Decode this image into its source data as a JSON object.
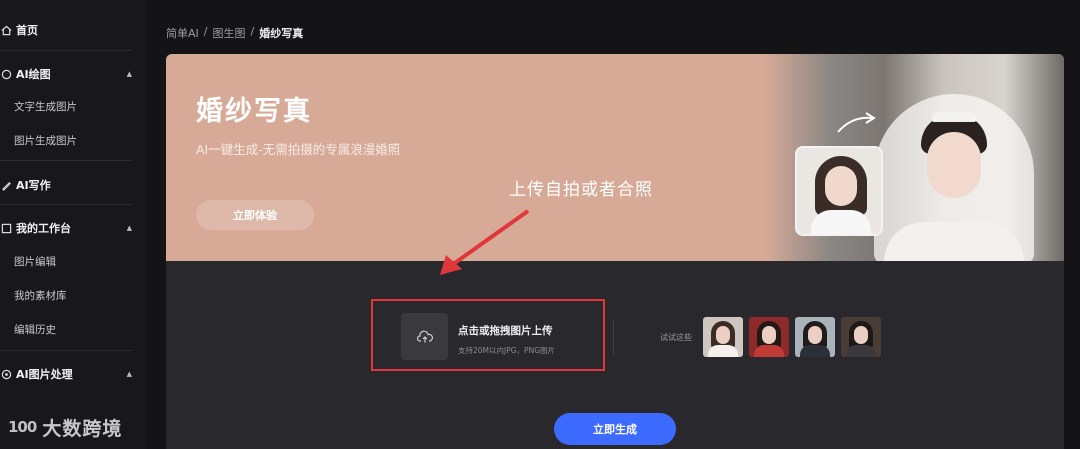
{
  "sidebar": {
    "home": "首页",
    "ai_draw": "AI绘图",
    "ai_draw_items": [
      "文字生成图片",
      "图片生成图片"
    ],
    "ai_write": "AI写作",
    "workspace": "我的工作台",
    "workspace_items": [
      "图片编辑",
      "我的素材库",
      "编辑历史"
    ],
    "ai_image": "AI图片处理"
  },
  "breadcrumb": [
    "简单AI",
    "/",
    "图生图",
    "/",
    "婚纱写真"
  ],
  "banner": {
    "title": "婚纱写真",
    "subtitle": "AI一键生成-无需拍摄的专属浪漫婚照",
    "try_button": "立即体验",
    "callout": "上传自拍或者合照"
  },
  "upload": {
    "title": "点击或拖拽图片上传",
    "hint": "支持20M以内JPG，PNG图片"
  },
  "samples": {
    "label": "试试这些"
  },
  "generate_button": "立即生成",
  "watermark": {
    "logo": "100",
    "text": "大数跨境"
  },
  "colors": {
    "accent": "#3d6bff",
    "highlight": "#e0383a",
    "banner_bg": "#d7aa97"
  }
}
